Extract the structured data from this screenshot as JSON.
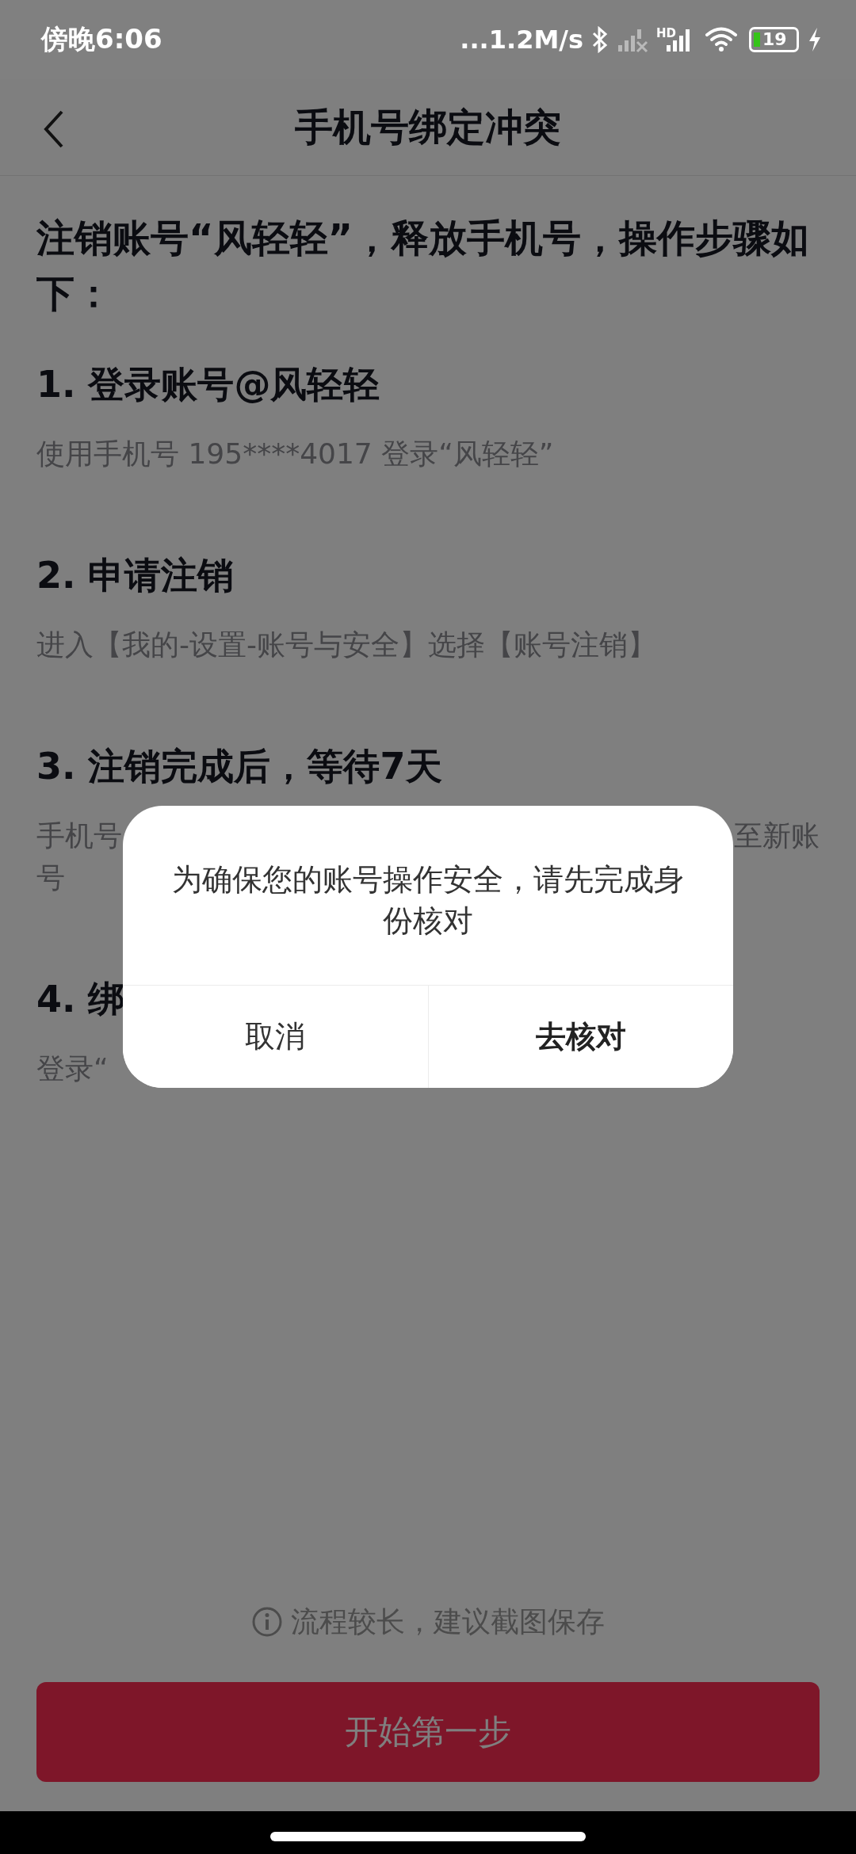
{
  "status_bar": {
    "time": "傍晚6:06",
    "network_speed": "...1.2M/s",
    "hd_label": "HD",
    "battery_text": "19"
  },
  "header": {
    "title": "手机号绑定冲突"
  },
  "intro": "注销账号“风轻轻”，释放手机号，操作步骤如下：",
  "steps": [
    {
      "title": "1. 登录账号@风轻轻",
      "description": [
        [
          "使用手机号 195****4017 登录“风轻轻”"
        ]
      ]
    },
    {
      "title": "2. 申请注销",
      "description": [
        [
          "进入【我的-设置-账号与安全】选择【账号注销】"
        ]
      ]
    },
    {
      "title": "3. 注销完成后，等待7天",
      "description": [
        [
          "手机号",
          "至新账"
        ],
        [
          "号"
        ]
      ]
    },
    {
      "title": "4. 绑",
      "description": [
        [
          "登录“"
        ]
      ]
    }
  ],
  "tip": "流程较长，建议截图保存",
  "primary_button": "开始第一步",
  "dialog": {
    "message": "为确保您的账号操作安全，请先完成身份核对",
    "buttons": [
      {
        "label": "取消",
        "kind": "cancel"
      },
      {
        "label": "去核对",
        "kind": "confirm"
      }
    ]
  }
}
